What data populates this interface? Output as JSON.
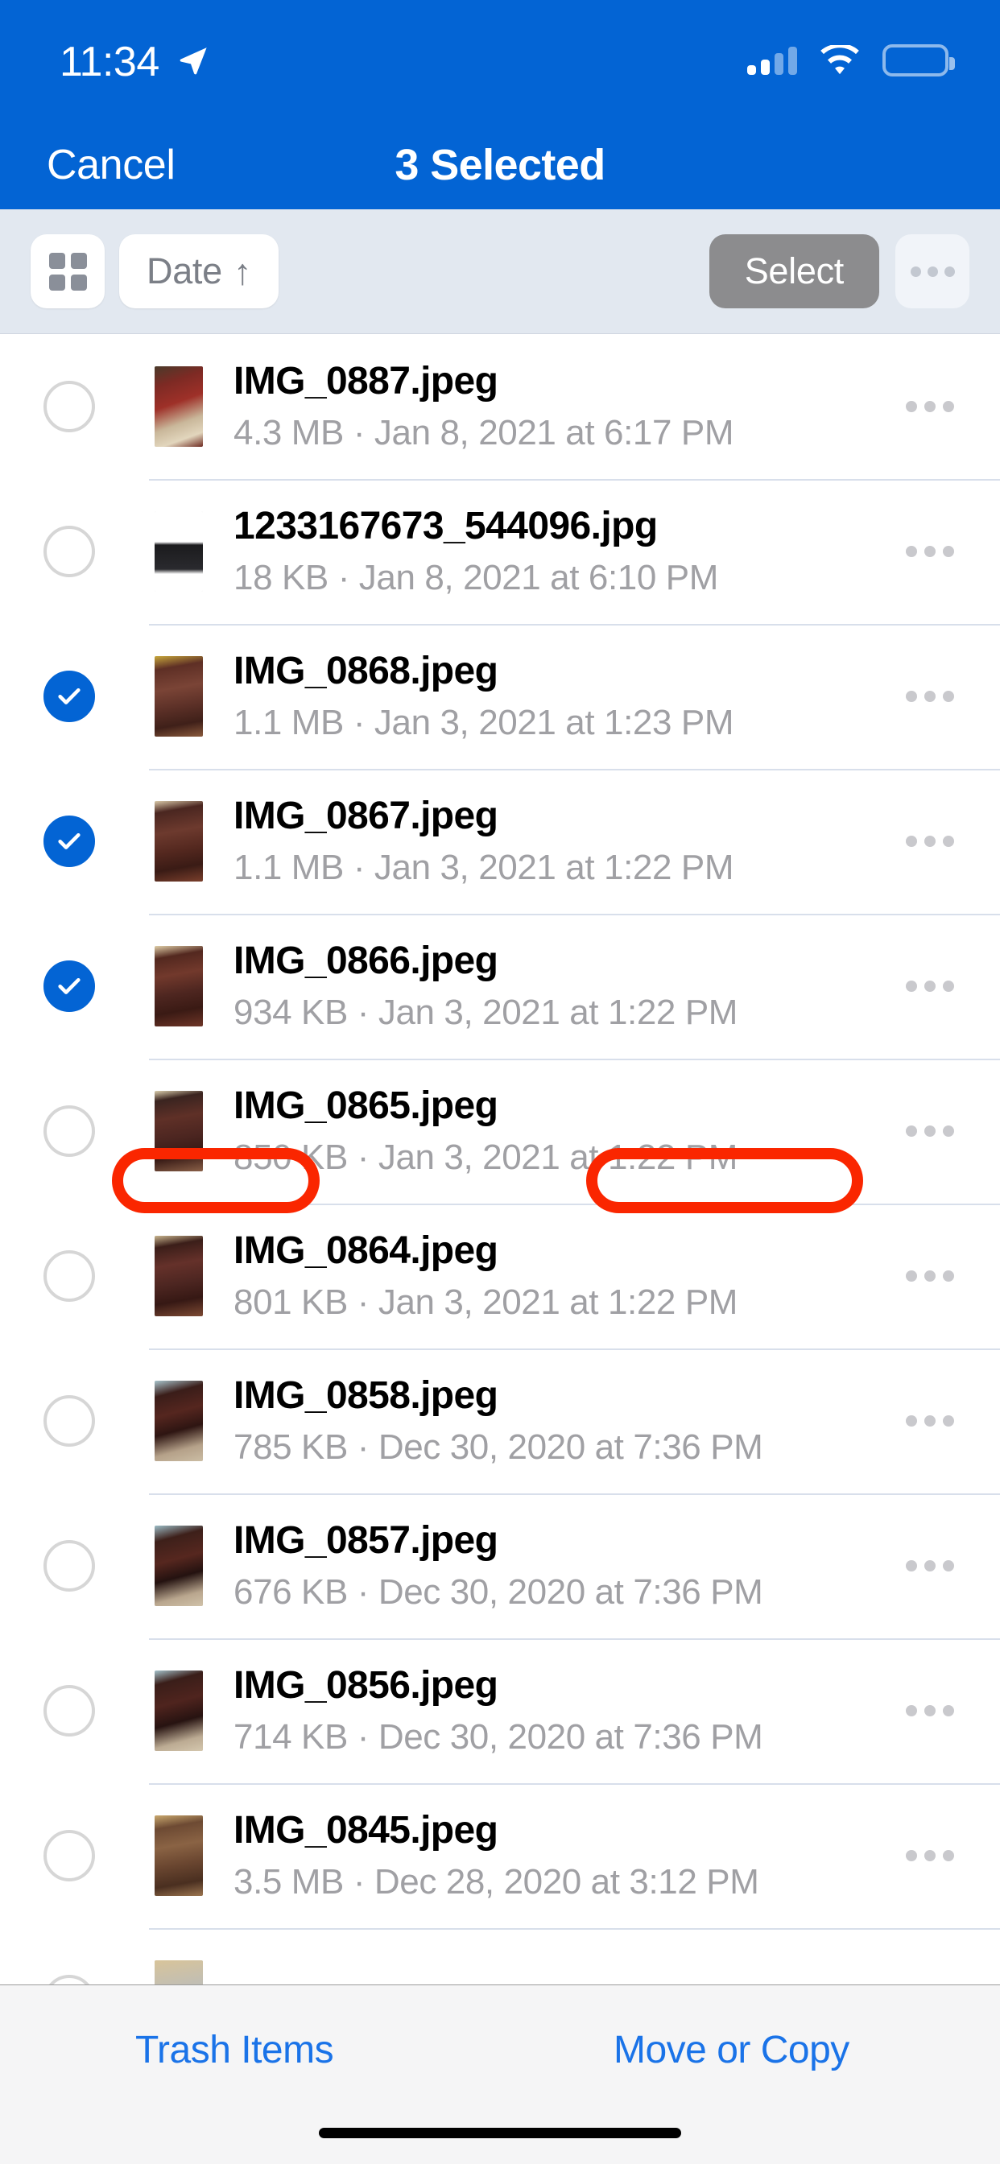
{
  "status_bar": {
    "time": "11:34",
    "location_icon": "location-arrow-icon",
    "signal_icon": "cellular-signal-icon",
    "signal_bars_filled": 2,
    "signal_bars_total": 4,
    "wifi_icon": "wifi-icon",
    "battery_icon": "battery-full-icon",
    "battery_level": "100"
  },
  "nav_bar": {
    "cancel_label": "Cancel",
    "title": "3 Selected",
    "background_color": "#0364d4"
  },
  "toolbar": {
    "grid_view_icon": "grid-view-icon",
    "sort_label": "Date",
    "sort_direction_icon": "↑",
    "select_label": "Select",
    "select_active": true,
    "more_icon": "more-horizontal-icon",
    "background_color": "#e2e8f0"
  },
  "file_list": {
    "more_icon": "more-horizontal-icon",
    "rows": [
      {
        "name": "IMG_0887.jpeg",
        "size": "4.3 MB",
        "separator": " · ",
        "date": "Jan 8, 2021 at 6:17 PM",
        "selected": false,
        "thumb": "rug"
      },
      {
        "name": "1233167673_544096.jpg",
        "size": "18 KB",
        "separator": " · ",
        "date": "Jan 8, 2021 at 6:10 PM",
        "selected": false,
        "thumb": "speakers"
      },
      {
        "name": "IMG_0868.jpeg",
        "size": "1.1 MB",
        "separator": " · ",
        "date": "Jan 3, 2021 at 1:23 PM",
        "selected": true,
        "thumb": "sofa-a"
      },
      {
        "name": "IMG_0867.jpeg",
        "size": "1.1 MB",
        "separator": " · ",
        "date": "Jan 3, 2021 at 1:22 PM",
        "selected": true,
        "thumb": "sofa-b"
      },
      {
        "name": "IMG_0866.jpeg",
        "size": "934 KB",
        "separator": " · ",
        "date": "Jan 3, 2021 at 1:22 PM",
        "selected": true,
        "thumb": "sofa-c"
      },
      {
        "name": "IMG_0865.jpeg",
        "size": "850 KB",
        "separator": " · ",
        "date": "Jan 3, 2021 at 1:22 PM",
        "selected": false,
        "thumb": "sofa-d"
      },
      {
        "name": "IMG_0864.jpeg",
        "size": "801 KB",
        "separator": " · ",
        "date": "Jan 3, 2021 at 1:22 PM",
        "selected": false,
        "thumb": "recliner"
      },
      {
        "name": "IMG_0858.jpeg",
        "size": "785 KB",
        "separator": " · ",
        "date": "Dec 30, 2020 at 7:36 PM",
        "selected": false,
        "thumb": "desk-a"
      },
      {
        "name": "IMG_0857.jpeg",
        "size": "676 KB",
        "separator": " · ",
        "date": "Dec 30, 2020 at 7:36 PM",
        "selected": false,
        "thumb": "desk-b"
      },
      {
        "name": "IMG_0856.jpeg",
        "size": "714 KB",
        "separator": " · ",
        "date": "Dec 30, 2020 at 7:36 PM",
        "selected": false,
        "thumb": "desk-c"
      },
      {
        "name": "IMG_0845.jpeg",
        "size": "3.5 MB",
        "separator": " · ",
        "date": "Dec 28, 2020 at 3:12 PM",
        "selected": false,
        "thumb": "seats"
      },
      {
        "name": "",
        "size": "",
        "separator": "",
        "date": "",
        "selected": false,
        "thumb": "partial"
      }
    ]
  },
  "bottom_bar": {
    "trash_label": "Trash Items",
    "move_label": "Move or Copy",
    "link_color": "#1a73e8",
    "annotation_color": "#fa2600",
    "home_indicator": "home-indicator"
  }
}
